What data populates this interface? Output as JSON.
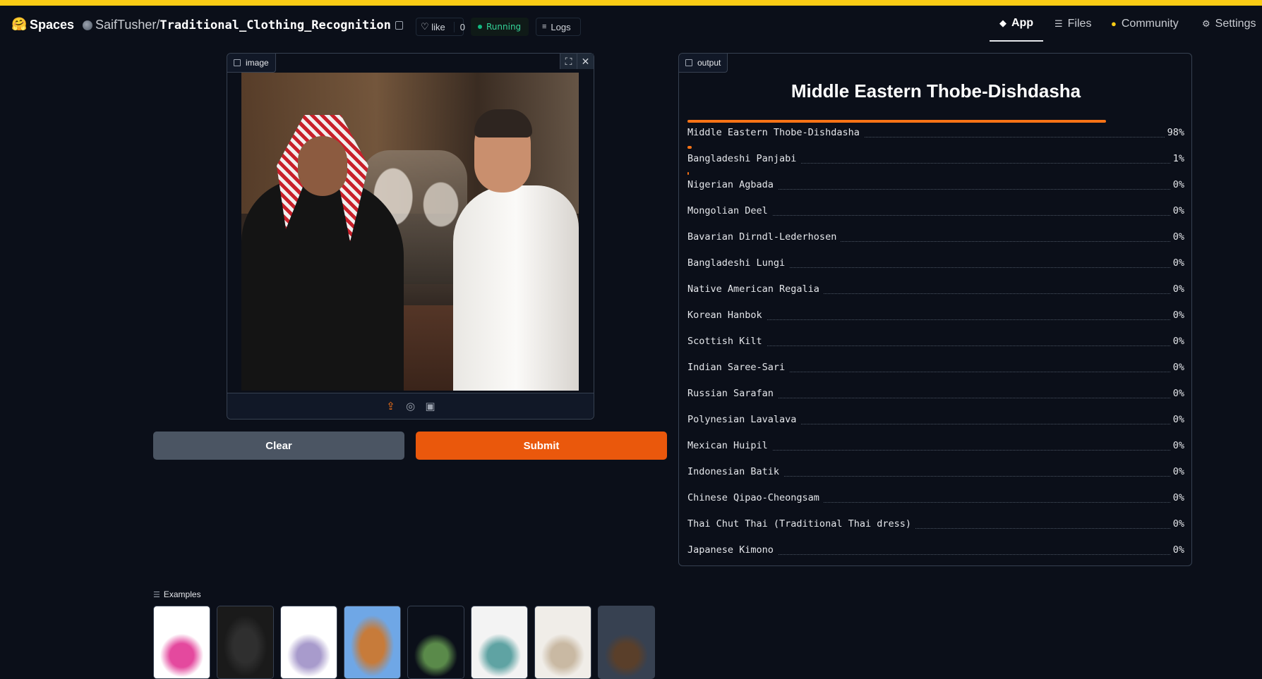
{
  "header": {
    "spaces_label": "Spaces",
    "owner": "SaifTusher/",
    "repo_name": "Traditional_Clothing_Recognition",
    "like_label": "like",
    "like_count": "0",
    "status": "Running",
    "logs_label": "Logs",
    "nav": {
      "app": "App",
      "files": "Files",
      "community": "Community",
      "settings": "Settings"
    }
  },
  "input": {
    "label": "image",
    "clear_label": "Clear",
    "submit_label": "Submit"
  },
  "output": {
    "label": "output",
    "top_class": "Middle Eastern Thobe-Dishdasha",
    "results": [
      {
        "label": "Middle Eastern Thobe-Dishdasha",
        "pct": "98%",
        "value": 0.98
      },
      {
        "label": "Bangladeshi Panjabi",
        "pct": "1%",
        "value": 0.01
      },
      {
        "label": "Nigerian Agbada",
        "pct": "0%",
        "value": 0.003
      },
      {
        "label": "Mongolian Deel",
        "pct": "0%",
        "value": 0
      },
      {
        "label": "Bavarian Dirndl-Lederhosen",
        "pct": "0%",
        "value": 0
      },
      {
        "label": "Bangladeshi Lungi",
        "pct": "0%",
        "value": 0
      },
      {
        "label": "Native American Regalia",
        "pct": "0%",
        "value": 0
      },
      {
        "label": "Korean Hanbok",
        "pct": "0%",
        "value": 0
      },
      {
        "label": "Scottish Kilt",
        "pct": "0%",
        "value": 0
      },
      {
        "label": "Indian Saree-Sari",
        "pct": "0%",
        "value": 0
      },
      {
        "label": "Russian Sarafan",
        "pct": "0%",
        "value": 0
      },
      {
        "label": "Polynesian Lavalava",
        "pct": "0%",
        "value": 0
      },
      {
        "label": "Mexican Huipil",
        "pct": "0%",
        "value": 0
      },
      {
        "label": "Indonesian Batik",
        "pct": "0%",
        "value": 0
      },
      {
        "label": "Chinese Qipao-Cheongsam",
        "pct": "0%",
        "value": 0
      },
      {
        "label": "Thai Chut Thai (Traditional Thai dress)",
        "pct": "0%",
        "value": 0
      },
      {
        "label": "Japanese Kimono",
        "pct": "0%",
        "value": 0
      }
    ]
  },
  "examples": {
    "label": "Examples",
    "thumbs": [
      {
        "colors": [
          "#ffffff",
          "#e4499e"
        ]
      },
      {
        "colors": [
          "#1a1a1a",
          "#2f2f2f"
        ]
      },
      {
        "colors": [
          "#ffffff",
          "#a89bcc"
        ]
      },
      {
        "colors": [
          "#6fa7e6",
          "#c77b3a"
        ]
      },
      {
        "colors": [
          "#0b0f19",
          "#5a8a4a"
        ]
      },
      {
        "colors": [
          "#f3f3f3",
          "#5fa3a3"
        ]
      },
      {
        "colors": [
          "#f0ede8",
          "#c9b9a3"
        ]
      },
      {
        "colors": [
          "#374151",
          "#5a3f2a"
        ]
      }
    ]
  },
  "colors": {
    "accent": "#ea580c",
    "bar": "#f97316",
    "background": "#0b0f19",
    "running": "#10b981"
  }
}
